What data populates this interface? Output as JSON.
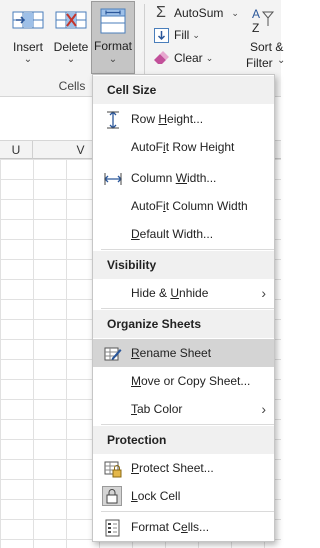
{
  "ribbon": {
    "insert_label": "Insert",
    "delete_label": "Delete",
    "format_label": "Format",
    "cells_group_label": "Cells",
    "autosum_label": "AutoSum",
    "fill_label": "Fill",
    "clear_label": "Clear",
    "sort_label": "Sort &",
    "filter_label": "Filter"
  },
  "columns": [
    "U",
    "V"
  ],
  "menu": {
    "cell_size": {
      "header": "Cell Size",
      "row_height": {
        "pre": "Row ",
        "key": "H",
        "post": "eight..."
      },
      "autofit_row": {
        "pre": "AutoF",
        "key": "i",
        "post": "t Row Height"
      },
      "column_width": {
        "pre": "Column ",
        "key": "W",
        "post": "idth..."
      },
      "autofit_col": {
        "pre": "AutoF",
        "key": "i",
        "post": "t Column Width"
      },
      "default_width": {
        "pre": "",
        "key": "D",
        "post": "efault Width..."
      }
    },
    "visibility": {
      "header": "Visibility",
      "hide_unhide": {
        "pre": "Hide & ",
        "key": "U",
        "post": "nhide"
      }
    },
    "organize": {
      "header": "Organize Sheets",
      "rename": {
        "pre": "",
        "key": "R",
        "post": "ename Sheet"
      },
      "move_copy": {
        "pre": "",
        "key": "M",
        "post": "ove or Copy Sheet..."
      },
      "tab_color": {
        "pre": "",
        "key": "T",
        "post": "ab Color"
      }
    },
    "protection": {
      "header": "Protection",
      "protect": {
        "pre": "",
        "key": "P",
        "post": "rotect Sheet..."
      },
      "lock": {
        "pre": "",
        "key": "L",
        "post": "ock Cell"
      },
      "format_cells": {
        "pre": "Format C",
        "key": "e",
        "post": "lls..."
      }
    }
  },
  "colors": {
    "accent_blue": "#2b579a",
    "icon_blue": "#4a7ebb",
    "eraser_pink": "#c2509a",
    "delete_red": "#c4362c",
    "highlight_gray": "#d4d4d4"
  }
}
